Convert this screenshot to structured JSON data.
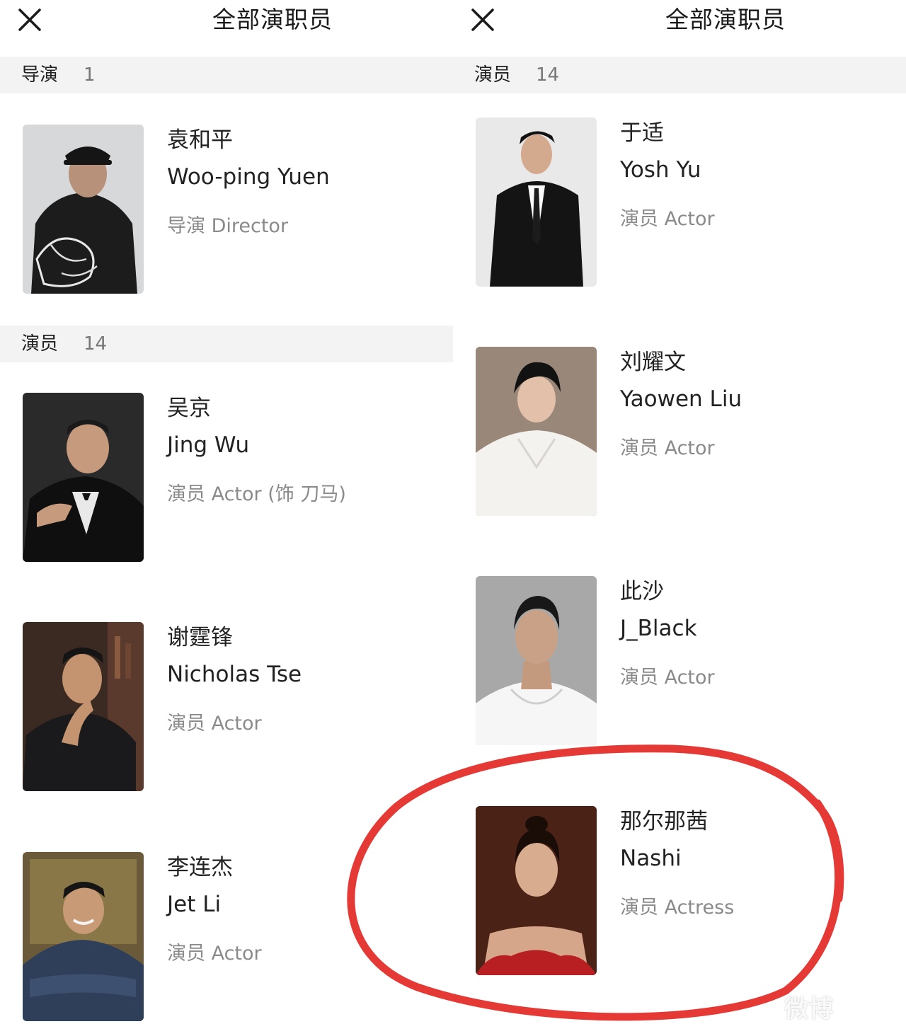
{
  "left_panel": {
    "title": "全部演职员",
    "close_icon": "close-icon",
    "sections": [
      {
        "title": "导演",
        "count": "1",
        "people": [
          {
            "name_cn": "袁和平",
            "name_en": "Woo-ping Yuen",
            "role": "导演 Director"
          }
        ]
      },
      {
        "title": "演员",
        "count": "14",
        "people": [
          {
            "name_cn": "吴京",
            "name_en": "Jing Wu",
            "role": "演员 Actor (饰 刀马)"
          },
          {
            "name_cn": "谢霆锋",
            "name_en": "Nicholas Tse",
            "role": "演员 Actor"
          },
          {
            "name_cn": "李连杰",
            "name_en": "Jet Li",
            "role": "演员 Actor"
          }
        ]
      }
    ]
  },
  "right_panel": {
    "title": "全部演职员",
    "close_icon": "close-icon",
    "sections": [
      {
        "title": "演员",
        "count": "14",
        "people": [
          {
            "name_cn": "于适",
            "name_en": "Yosh Yu",
            "role": "演员 Actor"
          },
          {
            "name_cn": "刘耀文",
            "name_en": "Yaowen Liu",
            "role": "演员 Actor"
          },
          {
            "name_cn": "此沙",
            "name_en": "J_Black",
            "role": "演员 Actor"
          },
          {
            "name_cn": "那尔那茜",
            "name_en": "Nashi",
            "role": "演员 Actress"
          }
        ]
      }
    ]
  },
  "annotation_color": "#e53935",
  "watermark": "微博"
}
